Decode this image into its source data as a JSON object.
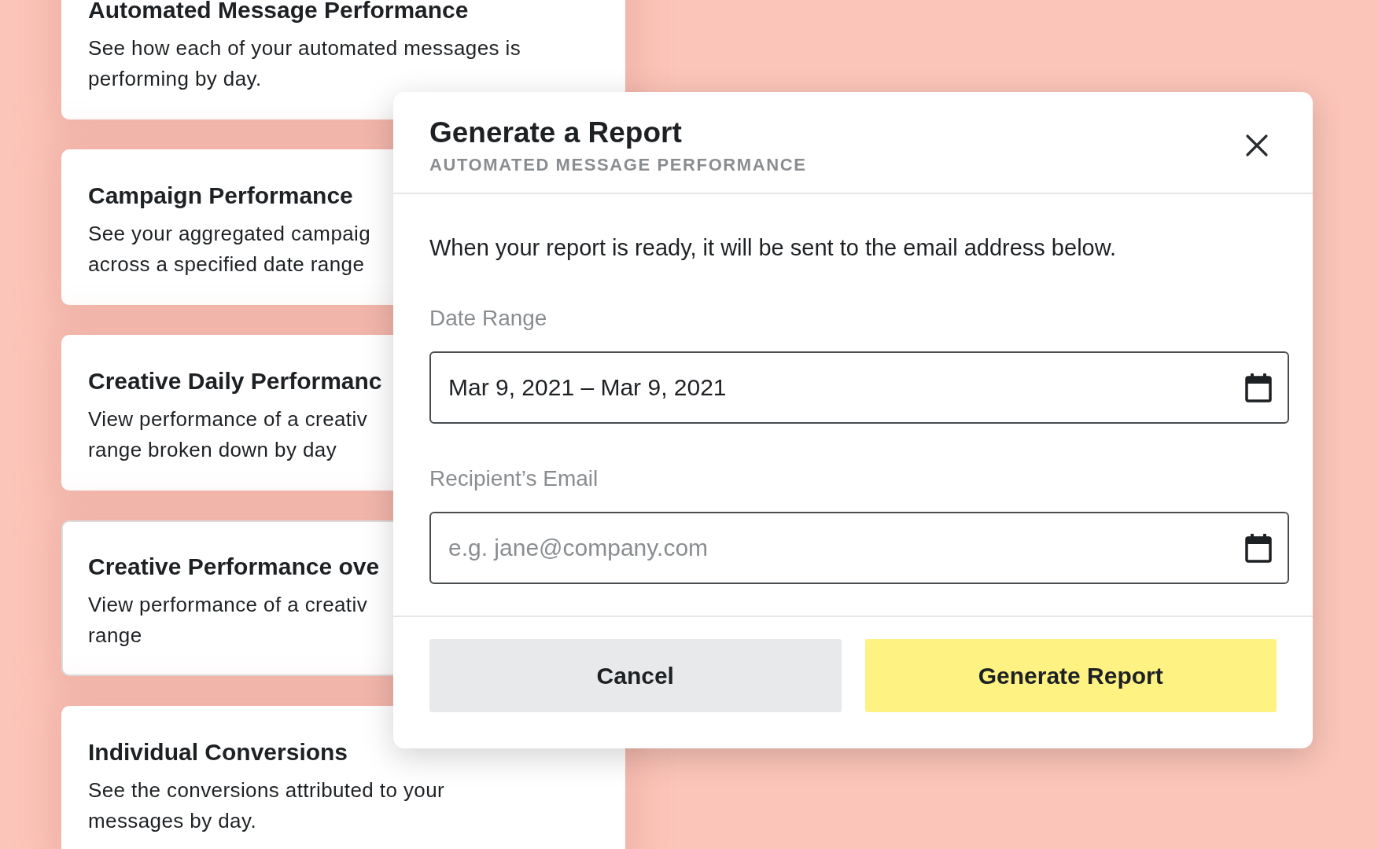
{
  "report_cards": [
    {
      "title": "Automated Message Performance",
      "description_lines": [
        "See how each of your automated messages is",
        "performing by day."
      ],
      "selected": false
    },
    {
      "title": "Campaign Performance",
      "description_lines": [
        "See your aggregated campaig",
        "across a specified date range"
      ],
      "selected": false
    },
    {
      "title": "Creative Daily Performanc",
      "description_lines": [
        "View performance of a creativ",
        "range broken down by day"
      ],
      "selected": false
    },
    {
      "title": "Creative Performance ove",
      "description_lines": [
        "View performance of a creativ",
        "range"
      ],
      "selected": true
    },
    {
      "title": "Individual Conversions",
      "description_lines": [
        "See the conversions attributed to your",
        "messages by day."
      ],
      "selected": false
    }
  ],
  "dialog": {
    "title": "Generate a Report",
    "subtitle": "AUTOMATED MESSAGE PERFORMANCE",
    "message": "When your report is ready, it will be sent to the email address below.",
    "fields": [
      {
        "label": "Date Range",
        "value": "Mar 9, 2021 – Mar 9, 2021"
      },
      {
        "label": "Recipient’s Email",
        "placeholder": "e.g. jane@company.com"
      }
    ],
    "buttons": [
      {
        "label": "Cancel",
        "kind": "secondary"
      },
      {
        "label": "Generate Report",
        "kind": "primary"
      }
    ]
  }
}
